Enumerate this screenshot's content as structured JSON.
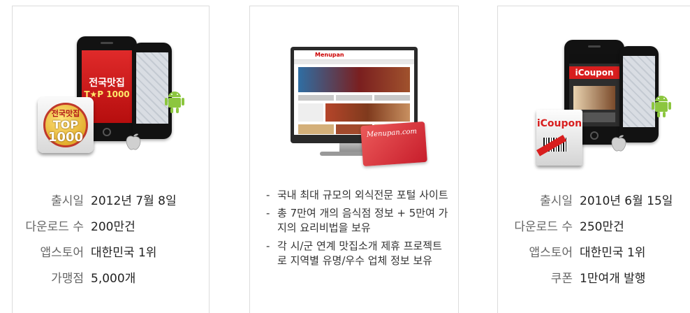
{
  "cards": [
    {
      "id": "top1000",
      "media": {
        "phone_title": "전국맛집",
        "phone_subtitle": "T★P 1000",
        "badge_line1": "전국맛집",
        "badge_line2": "TOP",
        "badge_line3": "1000"
      },
      "rows": [
        {
          "label": "출시일",
          "value": "2012년 7월 8일"
        },
        {
          "label": "다운로드 수",
          "value": "200만건"
        },
        {
          "label": "앱스토어",
          "value": "대한민국 1위"
        },
        {
          "label": "가맹점",
          "value": "5,000개"
        }
      ]
    },
    {
      "id": "menupan",
      "media": {
        "site_logo": "Menupan",
        "card_text": "Menupan.com"
      },
      "bullets": [
        "국내 최대 규모의 외식전문 포털 사이트",
        "총 7만여 개의 음식점 정보 + 5만여 가지의 요리비법을 보유",
        "각 시/군 연계 맛집소개 제휴 프로젝트로 지역별 유명/우수 업체 정보 보유"
      ]
    },
    {
      "id": "icoupon",
      "media": {
        "phone_title": "iCoupon",
        "box_title": "iCoupon"
      },
      "rows": [
        {
          "label": "출시일",
          "value": "2010년 6월 15일"
        },
        {
          "label": "다운로드 수",
          "value": "250만건"
        },
        {
          "label": "앱스토어",
          "value": "대한민국 1위"
        },
        {
          "label": "쿠폰",
          "value": "1만여개 발행"
        }
      ]
    }
  ],
  "colors": {
    "accent_red": "#d81e1e",
    "android_green": "#8cc63f",
    "border": "#dcdcdc"
  }
}
